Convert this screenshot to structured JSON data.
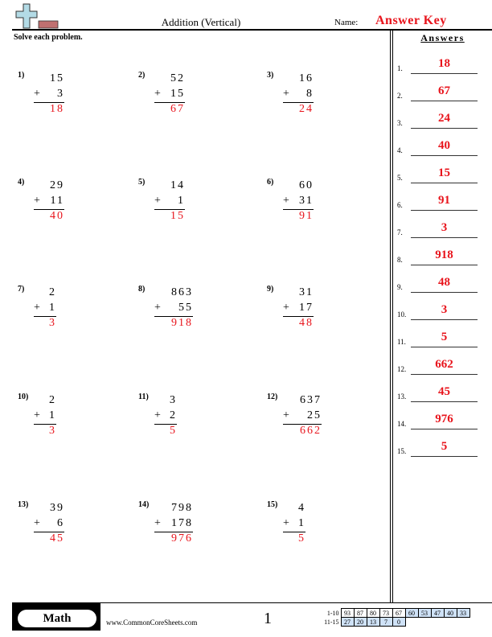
{
  "header": {
    "title": "Addition (Vertical)",
    "name_label": "Name:",
    "name_value": "Answer Key",
    "instructions": "Solve each problem."
  },
  "answers_panel": {
    "heading": "Answers",
    "items": [
      {
        "num": "1.",
        "value": "18"
      },
      {
        "num": "2.",
        "value": "67"
      },
      {
        "num": "3.",
        "value": "24"
      },
      {
        "num": "4.",
        "value": "40"
      },
      {
        "num": "5.",
        "value": "15"
      },
      {
        "num": "6.",
        "value": "91"
      },
      {
        "num": "7.",
        "value": "3"
      },
      {
        "num": "8.",
        "value": "918"
      },
      {
        "num": "9.",
        "value": "48"
      },
      {
        "num": "10.",
        "value": "3"
      },
      {
        "num": "11.",
        "value": "5"
      },
      {
        "num": "12.",
        "value": "662"
      },
      {
        "num": "13.",
        "value": "45"
      },
      {
        "num": "14.",
        "value": "976"
      },
      {
        "num": "15.",
        "value": "5"
      }
    ]
  },
  "problems": [
    {
      "label": "1)",
      "top": "15",
      "add": "3",
      "sum": "18"
    },
    {
      "label": "2)",
      "top": "52",
      "add": "15",
      "sum": "67"
    },
    {
      "label": "3)",
      "top": "16",
      "add": "8",
      "sum": "24"
    },
    {
      "label": "4)",
      "top": "29",
      "add": "11",
      "sum": "40"
    },
    {
      "label": "5)",
      "top": "14",
      "add": "1",
      "sum": "15"
    },
    {
      "label": "6)",
      "top": "60",
      "add": "31",
      "sum": "91"
    },
    {
      "label": "7)",
      "top": "2",
      "add": "1",
      "sum": "3"
    },
    {
      "label": "8)",
      "top": "863",
      "add": "55",
      "sum": "918"
    },
    {
      "label": "9)",
      "top": "31",
      "add": "17",
      "sum": "48"
    },
    {
      "label": "10)",
      "top": "2",
      "add": "1",
      "sum": "3"
    },
    {
      "label": "11)",
      "top": "3",
      "add": "2",
      "sum": "5"
    },
    {
      "label": "12)",
      "top": "637",
      "add": "25",
      "sum": "662"
    },
    {
      "label": "13)",
      "top": "39",
      "add": "6",
      "sum": "45"
    },
    {
      "label": "14)",
      "top": "798",
      "add": "178",
      "sum": "976"
    },
    {
      "label": "15)",
      "top": "4",
      "add": "1",
      "sum": "5"
    }
  ],
  "footer": {
    "subject": "Math",
    "website": "www.CommonCoreSheets.com",
    "page_number": "1",
    "score_rows": [
      {
        "label": "1-10",
        "cells": [
          "93",
          "87",
          "80",
          "73",
          "67",
          "60",
          "53",
          "47",
          "40",
          "33"
        ]
      },
      {
        "label": "11-15",
        "cells": [
          "27",
          "20",
          "13",
          "7",
          "0"
        ]
      }
    ]
  },
  "colors": {
    "answer_red": "#e8141c",
    "score_blue": "#cfe2f7"
  }
}
